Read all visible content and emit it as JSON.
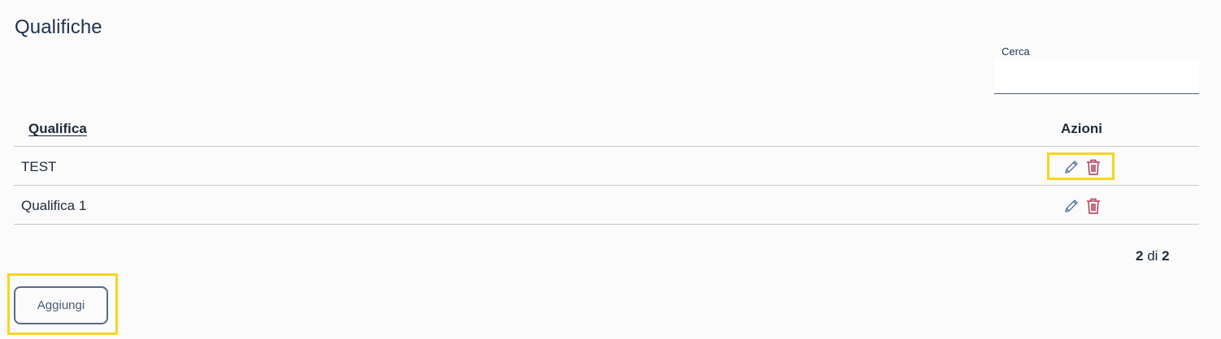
{
  "page": {
    "title": "Qualifiche"
  },
  "search": {
    "label": "Cerca",
    "value": "",
    "placeholder": ""
  },
  "table": {
    "columns": {
      "name": "Qualifica",
      "actions": "Azioni"
    },
    "rows": [
      {
        "name": "TEST"
      },
      {
        "name": "Qualifica 1"
      }
    ]
  },
  "pagination": {
    "current": "2",
    "separator": "di",
    "total": "2"
  },
  "buttons": {
    "add_label": "Aggiungi"
  },
  "icons": {
    "edit": "pencil-icon",
    "delete": "trash-icon"
  },
  "colors": {
    "edit_icon": "#5b6f9e",
    "delete_icon": "#b0334e",
    "highlight": "#f7d520",
    "title": "#1d3250"
  }
}
